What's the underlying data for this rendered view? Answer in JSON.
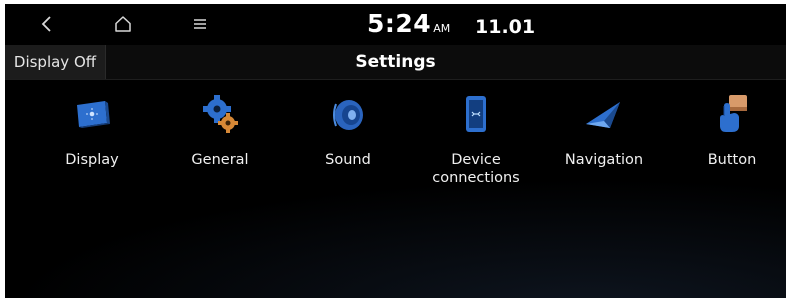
{
  "status": {
    "back_icon": "back-chevron-icon",
    "home_icon": "home-icon",
    "menu_icon": "menu-icon",
    "time": "5:24",
    "ampm": "AM",
    "date": "11.01"
  },
  "header": {
    "display_off_label": "Display Off",
    "title": "Settings"
  },
  "settings_items": [
    {
      "label": "Display",
      "icon": "display-icon"
    },
    {
      "label": "General",
      "icon": "gear-icon"
    },
    {
      "label": "Sound",
      "icon": "speaker-icon"
    },
    {
      "label": "Device\nconnections",
      "icon": "phone-icon"
    },
    {
      "label": "Navigation",
      "icon": "navigation-arrow-icon"
    },
    {
      "label": "Button",
      "icon": "hand-press-icon"
    }
  ],
  "colors": {
    "background": "#000000",
    "accent_blue": "#2f74d0",
    "text": "#ffffff"
  }
}
